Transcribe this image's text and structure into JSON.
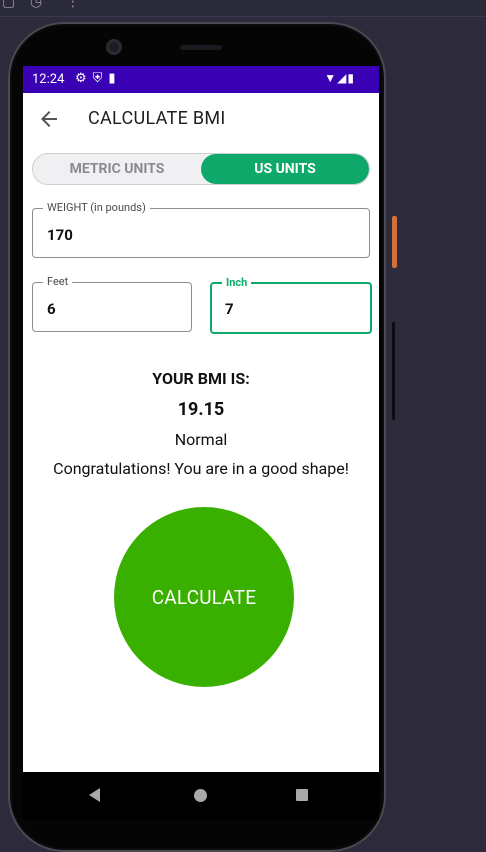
{
  "status": {
    "time": "12:24"
  },
  "appbar": {
    "title": "CALCULATE BMI"
  },
  "units": {
    "metric_label": "METRIC UNITS",
    "us_label": "US UNITS",
    "selected": "US UNITS"
  },
  "weight": {
    "label": "WEIGHT (in pounds)",
    "value": "170"
  },
  "feet": {
    "label": "Feet",
    "value": "6"
  },
  "inch": {
    "label": "Inch",
    "value": "7"
  },
  "result": {
    "heading": "YOUR BMI IS:",
    "value": "19.15",
    "category": "Normal",
    "message": "Congratulations! You are in a good shape!"
  },
  "calculate_button": {
    "label": "CALCULATE"
  },
  "colors": {
    "status_bar": "#3a00b4",
    "selected_tab": "#0ea86b",
    "calculate": "#39b000"
  },
  "icons": [
    "settings-icon",
    "shield-icon",
    "sd-card-icon",
    "wifi-icon",
    "signal-icon",
    "battery-icon",
    "back-arrow-icon",
    "nav-back-icon",
    "nav-home-icon",
    "nav-recents-icon"
  ]
}
